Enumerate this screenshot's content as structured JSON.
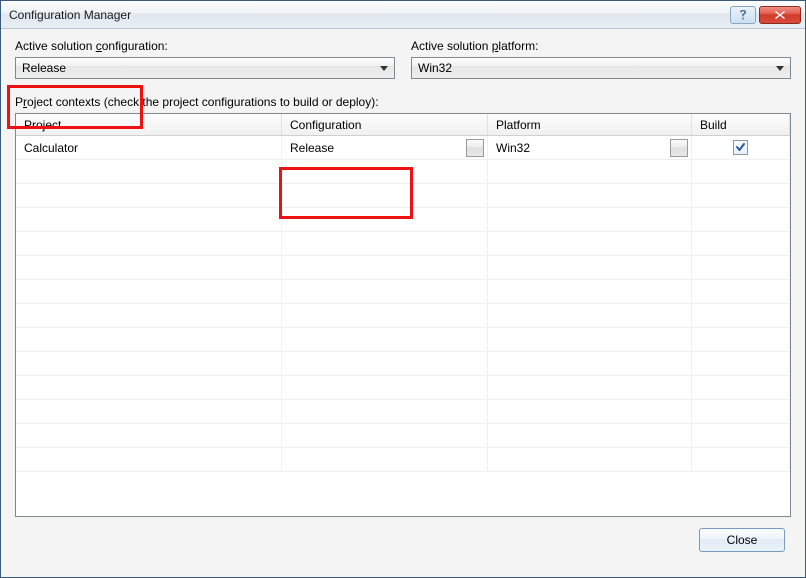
{
  "window": {
    "title": "Configuration Manager"
  },
  "labels": {
    "active_solution_configuration": "Active solution configuration:",
    "active_solution_platform": "Active solution platform:",
    "project_contexts": "Project contexts (check the project configurations to build or deploy):"
  },
  "active_solution_configuration": {
    "value": "Release"
  },
  "active_solution_platform": {
    "value": "Win32"
  },
  "grid": {
    "headers": {
      "project": "Project",
      "configuration": "Configuration",
      "platform": "Platform",
      "build": "Build"
    },
    "rows": [
      {
        "project": "Calculator",
        "configuration": "Release",
        "platform": "Win32",
        "build": true
      }
    ]
  },
  "buttons": {
    "close": "Close"
  }
}
